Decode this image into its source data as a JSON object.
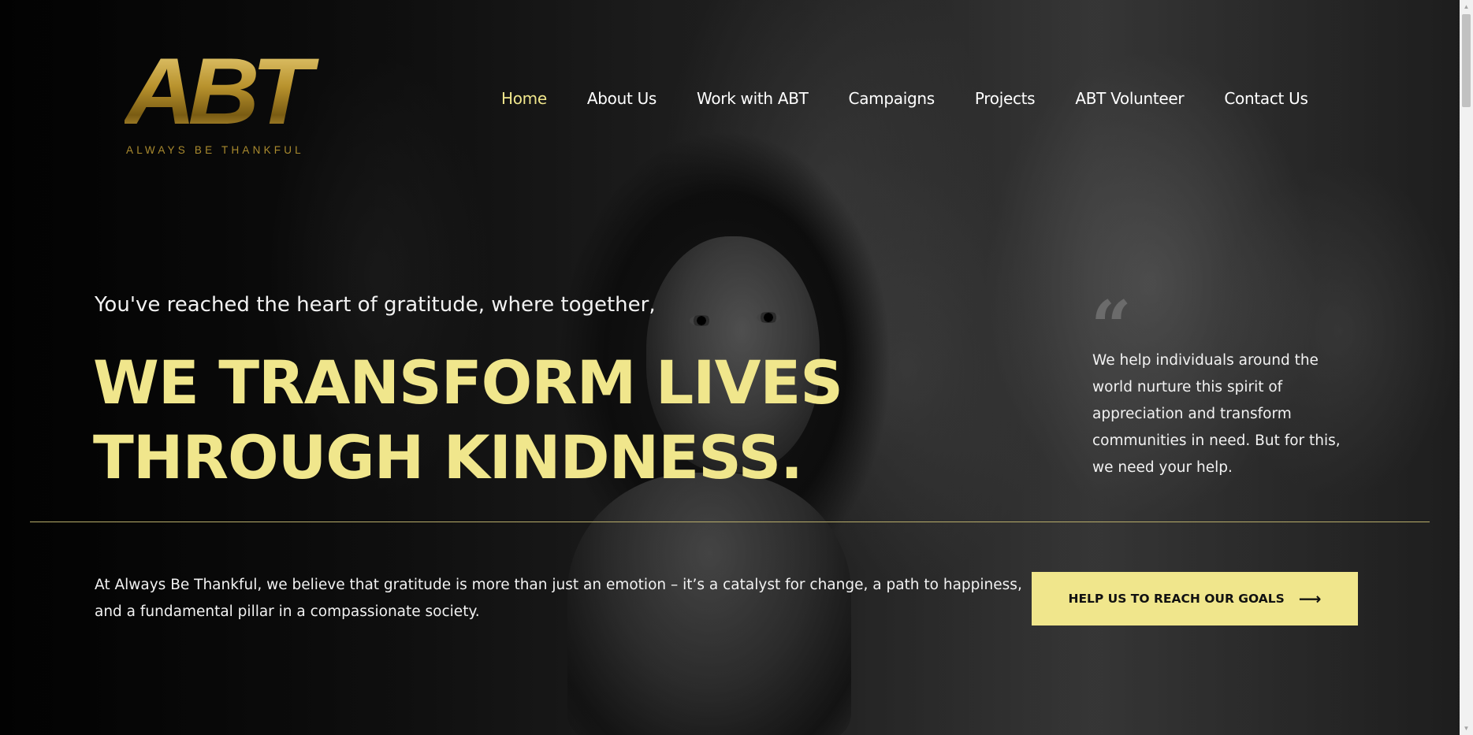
{
  "logo": {
    "letters": "ABT",
    "tagline": "ALWAYS BE THANKFUL"
  },
  "nav": {
    "items": [
      {
        "label": "Home",
        "active": true
      },
      {
        "label": "About Us",
        "active": false
      },
      {
        "label": "Work with ABT",
        "active": false
      },
      {
        "label": "Campaigns",
        "active": false
      },
      {
        "label": "Projects",
        "active": false
      },
      {
        "label": "ABT Volunteer",
        "active": false
      },
      {
        "label": "Contact Us",
        "active": false
      }
    ]
  },
  "hero": {
    "lead": "You've reached the heart of gratitude, where together,",
    "headline_line1": "WE TRANSFORM LIVES",
    "headline_line2": "THROUGH KINDNESS.",
    "quote_mark": "“",
    "quote": "We help individuals around the world nurture this spirit of appreciation and transform communities in need. But for this, we need your help.",
    "body": "At Always Be Thankful, we believe that gratitude is more than just an emotion – it’s a catalyst for change, a path to happiness, and a fundamental pillar in a compassionate society.",
    "cta_label": "HELP US TO REACH OUR GOALS",
    "cta_icon": "arrow-right-icon"
  },
  "colors": {
    "accent": "#f0e68c",
    "logo_gold": "#b8922d",
    "text": "#ffffff"
  }
}
